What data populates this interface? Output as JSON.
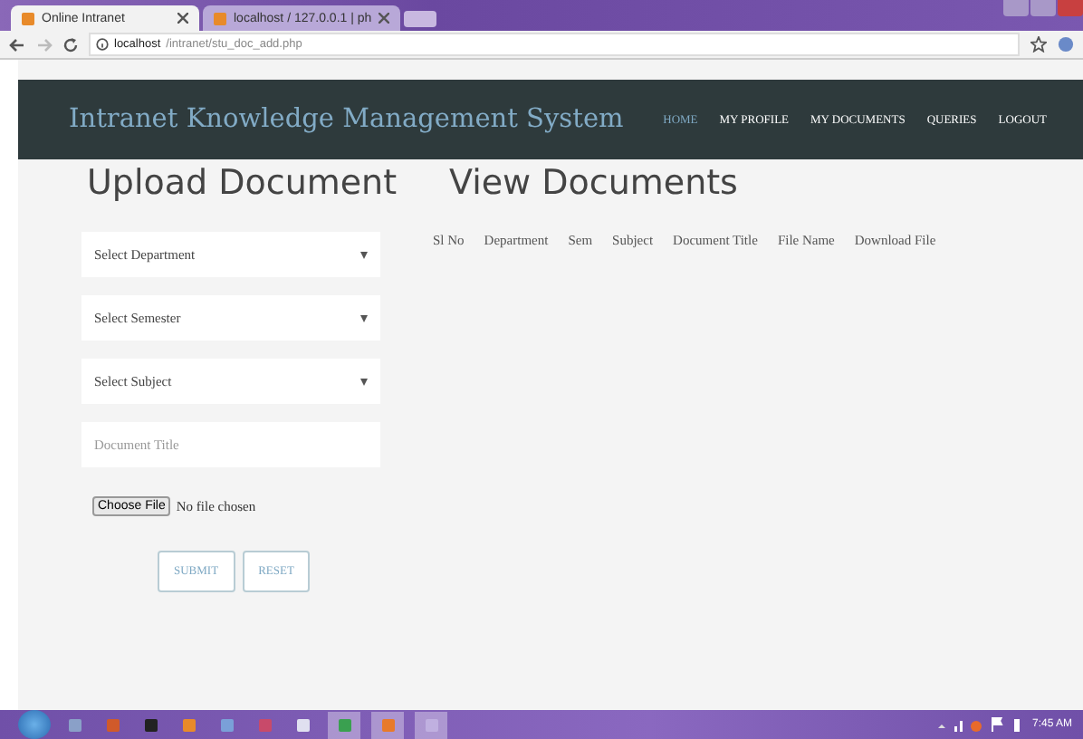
{
  "browser": {
    "tabs": [
      {
        "label": "Online Intranet",
        "selected": true
      },
      {
        "label": "localhost / 127.0.0.1 | ph",
        "selected": false
      }
    ],
    "address": {
      "host": "localhost",
      "path": "/intranet/stu_doc_add.php"
    }
  },
  "navbar": {
    "brand": "Intranet Knowledge Management System",
    "items": [
      {
        "label": "HOME",
        "selected": true
      },
      {
        "label": "MY PROFILE",
        "selected": false
      },
      {
        "label": "MY DOCUMENTS",
        "selected": false
      },
      {
        "label": "QUERIES",
        "selected": false
      },
      {
        "label": "LOGOUT",
        "selected": false
      }
    ]
  },
  "upload": {
    "heading": "Upload Document",
    "fields": [
      {
        "kind": "select",
        "placeholder": "Select Department"
      },
      {
        "kind": "select",
        "placeholder": "Select Semester"
      },
      {
        "kind": "select",
        "placeholder": "Select Subject"
      },
      {
        "kind": "text",
        "placeholder": "Document Title"
      }
    ],
    "file": {
      "button": "Choose File",
      "status": "No file chosen"
    },
    "buttons": [
      "SUBMIT",
      "RESET"
    ]
  },
  "view": {
    "heading": "View Documents",
    "table": {
      "columns": [
        "Sl No",
        "Department",
        "Sem",
        "Subject",
        "Document Title",
        "File Name",
        "Download File"
      ]
    }
  },
  "taskbar": {
    "apps": [
      {
        "color": "#8aa0c8",
        "active": false
      },
      {
        "color": "#d05a2a",
        "active": false
      },
      {
        "color": "#222222",
        "active": false
      },
      {
        "color": "#e88a2a",
        "active": false
      },
      {
        "color": "#7aa0d8",
        "active": false
      },
      {
        "color": "#c84a6a",
        "active": false
      },
      {
        "color": "#e0e0f0",
        "active": false
      },
      {
        "color": "#3aa050",
        "active": true
      },
      {
        "color": "#e87a2a",
        "active": true
      },
      {
        "color": "#c0b0e0",
        "active": true
      }
    ],
    "time": "7:45 AM"
  }
}
